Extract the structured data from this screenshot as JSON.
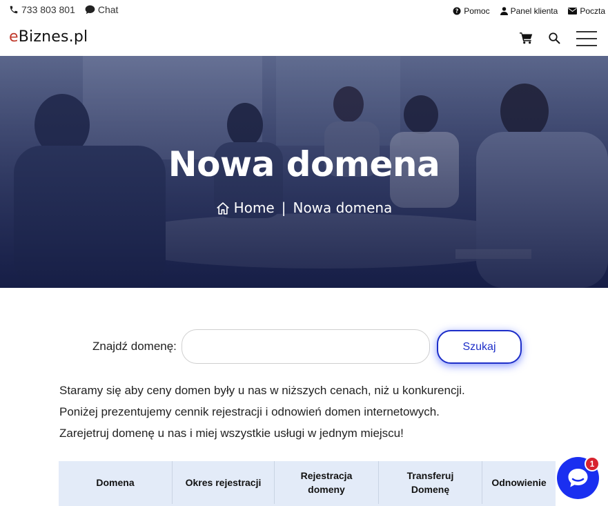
{
  "topbar": {
    "phone": "733 803 801",
    "chat": "Chat",
    "help": "Pomoc",
    "client_panel": "Panel klienta",
    "mail": "Poczta"
  },
  "header": {
    "logo_accent": "e",
    "logo_rest": "Biznes.pl",
    "icons": [
      "cart-icon",
      "search-icon",
      "hamburger-menu-icon"
    ]
  },
  "hero": {
    "title": "Nowa domena",
    "breadcrumb_home": "Home",
    "breadcrumb_separator": "|",
    "breadcrumb_current": "Nowa domena"
  },
  "domain_search": {
    "label": "Znajdź domenę:",
    "value": "",
    "placeholder": "",
    "button": "Szukaj"
  },
  "description": [
    "Staramy się aby ceny domen były u nas w niższych cenach, niż u konkurencji.",
    "Poniżej prezentujemy cennik rejestracji i odnowień domen internetowych.",
    "Zarejetruj domenę u nas i miej wszystkie usługi w jednym miejscu!"
  ],
  "table": {
    "headers": [
      "Domena",
      "Okres rejestracji",
      "Rejestracja\ndomeny",
      "Transferuj\nDomenę",
      "Odnowienie"
    ]
  },
  "chat_widget": {
    "badge_count": "1"
  },
  "colors": {
    "accent_blue": "#1d2ec8",
    "chat_blue": "#1a2ff0",
    "logo_red": "#c0392b",
    "table_header_bg": "#e3ebf8",
    "hero_overlay": "#1c2450",
    "badge_red": "#d7232e"
  }
}
